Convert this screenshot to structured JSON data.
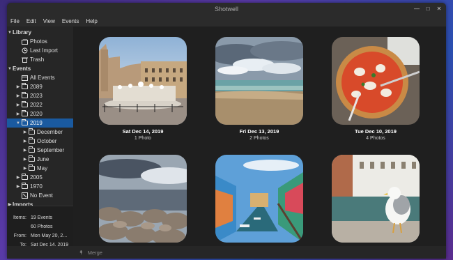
{
  "window": {
    "title": "Shotwell"
  },
  "menu": [
    "File",
    "Edit",
    "View",
    "Events",
    "Help"
  ],
  "sidebar": {
    "library": {
      "label": "Library",
      "items": [
        {
          "label": "Photos",
          "icon": "photos-icon"
        },
        {
          "label": "Last Import",
          "icon": "last-import-icon"
        },
        {
          "label": "Trash",
          "icon": "trash-icon"
        }
      ]
    },
    "events": {
      "label": "Events",
      "all": "All Events",
      "years": [
        {
          "label": "2089"
        },
        {
          "label": "2023"
        },
        {
          "label": "2022"
        },
        {
          "label": "2020"
        },
        {
          "label": "2019",
          "selected": true,
          "expanded": true,
          "months": [
            {
              "label": "December"
            },
            {
              "label": "October"
            },
            {
              "label": "September"
            },
            {
              "label": "June"
            },
            {
              "label": "May"
            }
          ]
        },
        {
          "label": "2005"
        },
        {
          "label": "1970"
        }
      ],
      "no_event": "No Event"
    },
    "imports": {
      "label": "Imports"
    }
  },
  "info": {
    "items_label": "Items:",
    "items_value": "19 Events",
    "photos_value": "60 Photos",
    "from_label": "From:",
    "from_value": "Mon May 20, 2...",
    "to_label": "To:",
    "to_value": "Sat Dec 14, 2019"
  },
  "events_grid": [
    {
      "date": "Sat Dec 14, 2019",
      "count": "1 Photo",
      "scene": "plaza"
    },
    {
      "date": "Fri Dec 13, 2019",
      "count": "2 Photos",
      "scene": "beach"
    },
    {
      "date": "Tue Dec 10, 2019",
      "count": "4 Photos",
      "scene": "pizza"
    },
    {
      "scene": "rocks"
    },
    {
      "scene": "canal"
    },
    {
      "scene": "gull"
    }
  ],
  "toolbar": {
    "merge_label": "Merge"
  },
  "colors": {
    "selection": "#1a5aa0",
    "window_bg": "#202020"
  }
}
